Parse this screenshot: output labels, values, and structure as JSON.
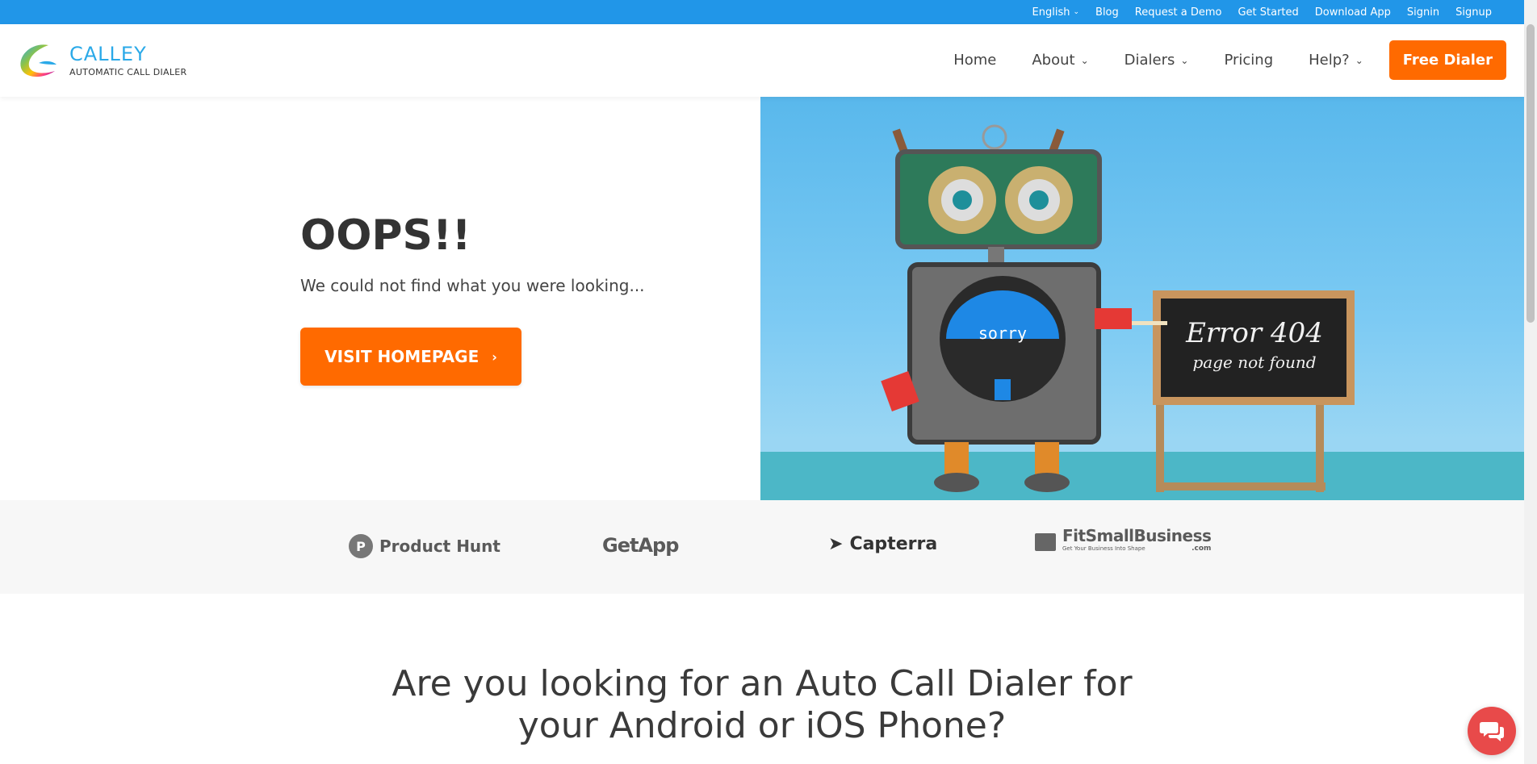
{
  "topbar": {
    "language": "English",
    "links": [
      "Blog",
      "Request a Demo",
      "Get Started",
      "Download App",
      "Signin",
      "Signup"
    ]
  },
  "header": {
    "brand": "CALLEY",
    "tagline": "AUTOMATIC CALL DIALER",
    "nav": {
      "home": "Home",
      "about": "About",
      "dialers": "Dialers",
      "pricing": "Pricing",
      "help": "Help?",
      "cta": "Free Dialer"
    }
  },
  "hero": {
    "title": "OOPS!!",
    "subtitle": "We could not find what you were looking...",
    "button": "VISIT HOMEPAGE",
    "image": {
      "screen_text": "sorry",
      "board_line1": "Error 404",
      "board_line2": "page not found"
    }
  },
  "partners": {
    "producthunt": "Product Hunt",
    "getapp": "GetApp",
    "capterra": "Capterra",
    "fitsmall": "FitSmallBusiness",
    "fitsmall_sub": "Get Your Business Into Shape",
    "fitsmall_com": ".com"
  },
  "section": {
    "title_line1": "Are you looking for an Auto Call Dialer for",
    "title_line2": "your Android or iOS Phone?"
  },
  "colors": {
    "topbar": "#2196e8",
    "accent": "#ff6a00",
    "brand": "#2aa9e8",
    "chat": "#e84a4a"
  }
}
